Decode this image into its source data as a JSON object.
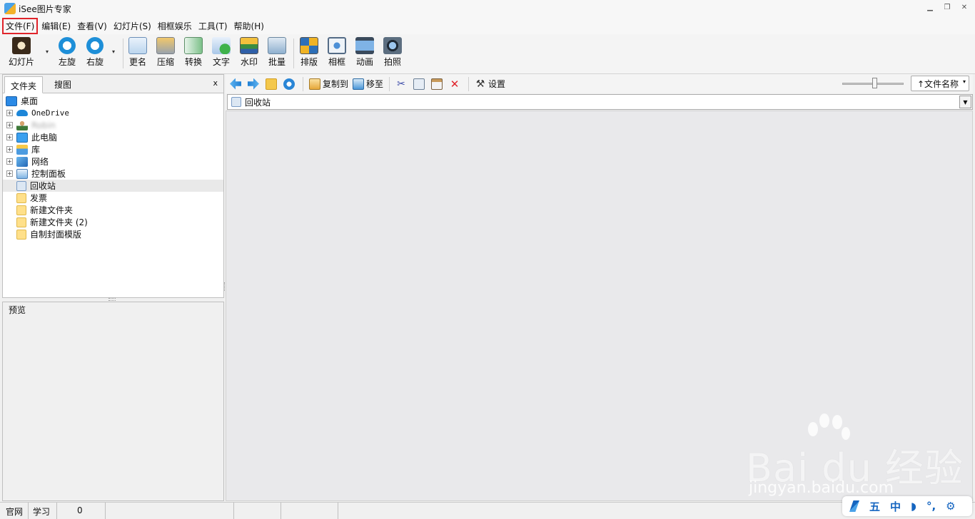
{
  "window": {
    "title": "iSee图片专家",
    "min": "▁",
    "restore": "❐",
    "close": "✕"
  },
  "menu": [
    "文件(F)",
    "编辑(E)",
    "查看(V)",
    "幻灯片(S)",
    "相框娱乐",
    "工具(T)",
    "帮助(H)"
  ],
  "toolbar": {
    "slideshow": "幻灯片",
    "rotate_left": "左旋",
    "rotate_right": "右旋",
    "rename": "更名",
    "compress": "压缩",
    "convert": "转换",
    "text": "文字",
    "watermark": "水印",
    "batch": "批量",
    "layout": "排版",
    "frame": "相框",
    "animation": "动画",
    "photo": "拍照",
    "dropdown": "▾"
  },
  "left_panel": {
    "tabs": [
      "文件夹",
      "搜图"
    ],
    "close": "x",
    "tree": [
      {
        "label": "桌面",
        "expander": "",
        "level": 0
      },
      {
        "label": "OneDrive",
        "expander": "+",
        "level": 1
      },
      {
        "label": "Robin",
        "expander": "+",
        "level": 1
      },
      {
        "label": "此电脑",
        "expander": "+",
        "level": 1
      },
      {
        "label": "库",
        "expander": "+",
        "level": 1
      },
      {
        "label": "网络",
        "expander": "+",
        "level": 1
      },
      {
        "label": "控制面板",
        "expander": "+",
        "level": 1
      },
      {
        "label": "回收站",
        "expander": "",
        "level": 1
      },
      {
        "label": "发票",
        "expander": "",
        "level": 1
      },
      {
        "label": "新建文件夹",
        "expander": "",
        "level": 1
      },
      {
        "label": "新建文件夹 (2)",
        "expander": "",
        "level": 1
      },
      {
        "label": "自制封面模版",
        "expander": "",
        "level": 1
      }
    ],
    "preview_label": "预览"
  },
  "right_toolbar": {
    "copy_to": "复制到",
    "move_to": "移至",
    "settings": "设置",
    "sort": "↑文件名称",
    "sort_arrow": "▾"
  },
  "address": {
    "path": "回收站",
    "drop": "▼"
  },
  "watermark": {
    "text": "Bai du 经验",
    "sub": "jingyan.baidu.com"
  },
  "status": {
    "site": "官网",
    "learn": "学习",
    "count": "0"
  },
  "ime": [
    "五",
    "中",
    "◗",
    "°,",
    "⚙"
  ],
  "colors": {
    "accent": "#1565c0",
    "highlight_border": "#e0242b"
  }
}
